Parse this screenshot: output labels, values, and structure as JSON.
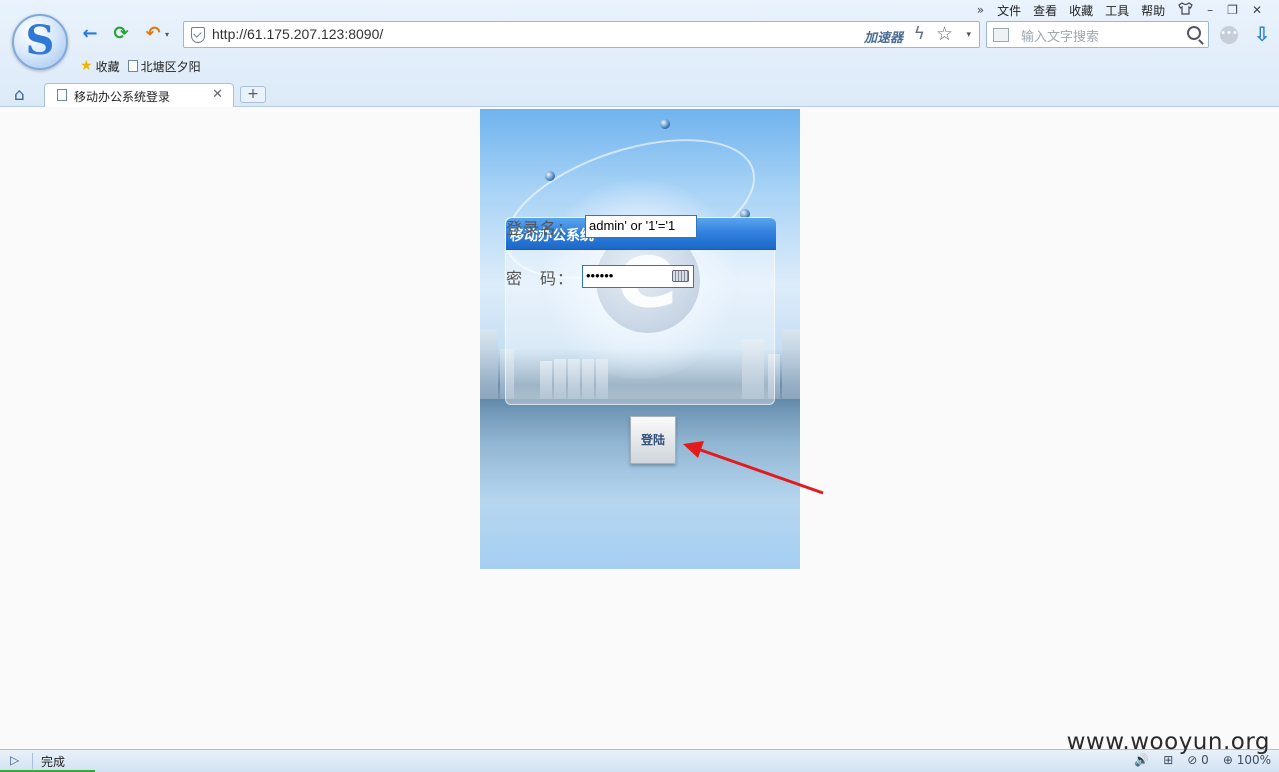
{
  "browser": {
    "menu": {
      "expand_glyph": "»",
      "items": [
        "文件",
        "查看",
        "收藏",
        "工具",
        "帮助"
      ],
      "shirt_glyph": "👕",
      "minimize": "–",
      "restore": "❐",
      "close": "✕"
    },
    "nav": {
      "back": "←",
      "refresh": "⟳",
      "undo": "↶",
      "undo_caret": "▾"
    },
    "address": {
      "url": "http://61.175.207.123:8090/",
      "accelerator": "加速器",
      "bolt": "ϟ",
      "star": "☆",
      "caret": "▾"
    },
    "search": {
      "placeholder": "输入文字搜索"
    },
    "more": "•••",
    "download": "⇩",
    "favorites": [
      {
        "label": "收藏"
      },
      {
        "label": "北塘区夕阳"
      }
    ],
    "tab": {
      "title": "移动办公系统登录",
      "close": "✕"
    },
    "new_tab": "+",
    "home": "⌂"
  },
  "login": {
    "title": "移动办公系统",
    "username_label": "登录名：",
    "username_value": "admin' or '1'='1",
    "password_label": "密　码：",
    "password_value": "••••••",
    "submit_label": "登陆",
    "e_glyph": "e"
  },
  "statusbar": {
    "toggle": "▷",
    "status": "完成",
    "icons": {
      "volume": "🔊",
      "medkit": "⊞",
      "block_count": "0",
      "zoom": "100%"
    }
  },
  "watermark": "www.wooyun.org",
  "colors": {
    "arrow": "#e31b1b",
    "header_blue": "#2f7fdc",
    "address_border": "#9fb6cf"
  }
}
